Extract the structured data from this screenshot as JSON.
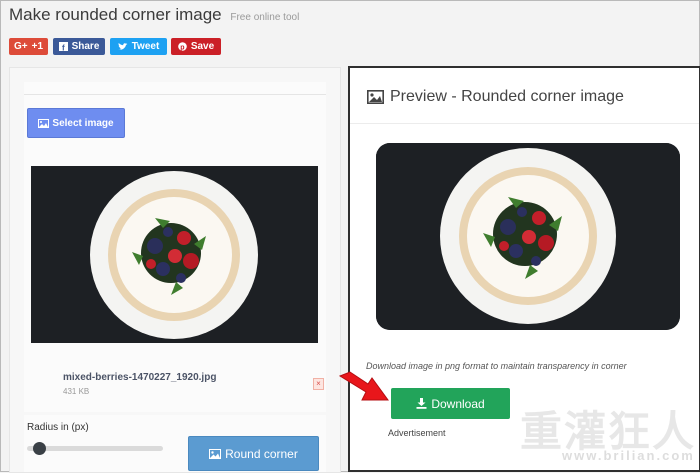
{
  "page": {
    "title": "Make rounded corner image",
    "subtitle": "Free online tool"
  },
  "share": {
    "gplus_label": "+1",
    "gplus_icon": "G+",
    "facebook_label": "Share",
    "twitter_label": "Tweet",
    "pinterest_label": "Save"
  },
  "left": {
    "select_label": "Select image",
    "file_name": "mixed-berries-1470227_1920.jpg",
    "file_size": "431 KB",
    "remove_glyph": "×",
    "radius_label": "Radius in (px)",
    "radius_value": 5,
    "round_label": "Round corner"
  },
  "right": {
    "preview_title": "Preview - Rounded corner image",
    "note": "Download image in png format to maintain transparency in corner",
    "download_label": "Download",
    "ad_label": "Advertisement"
  },
  "watermark": {
    "text": "重灌狂人",
    "url": "www.brilian.com"
  },
  "colors": {
    "select_button": "#6e8df0",
    "round_button": "#5b9bd1",
    "download_button": "#22a45a",
    "arrow": "#e8161b"
  }
}
